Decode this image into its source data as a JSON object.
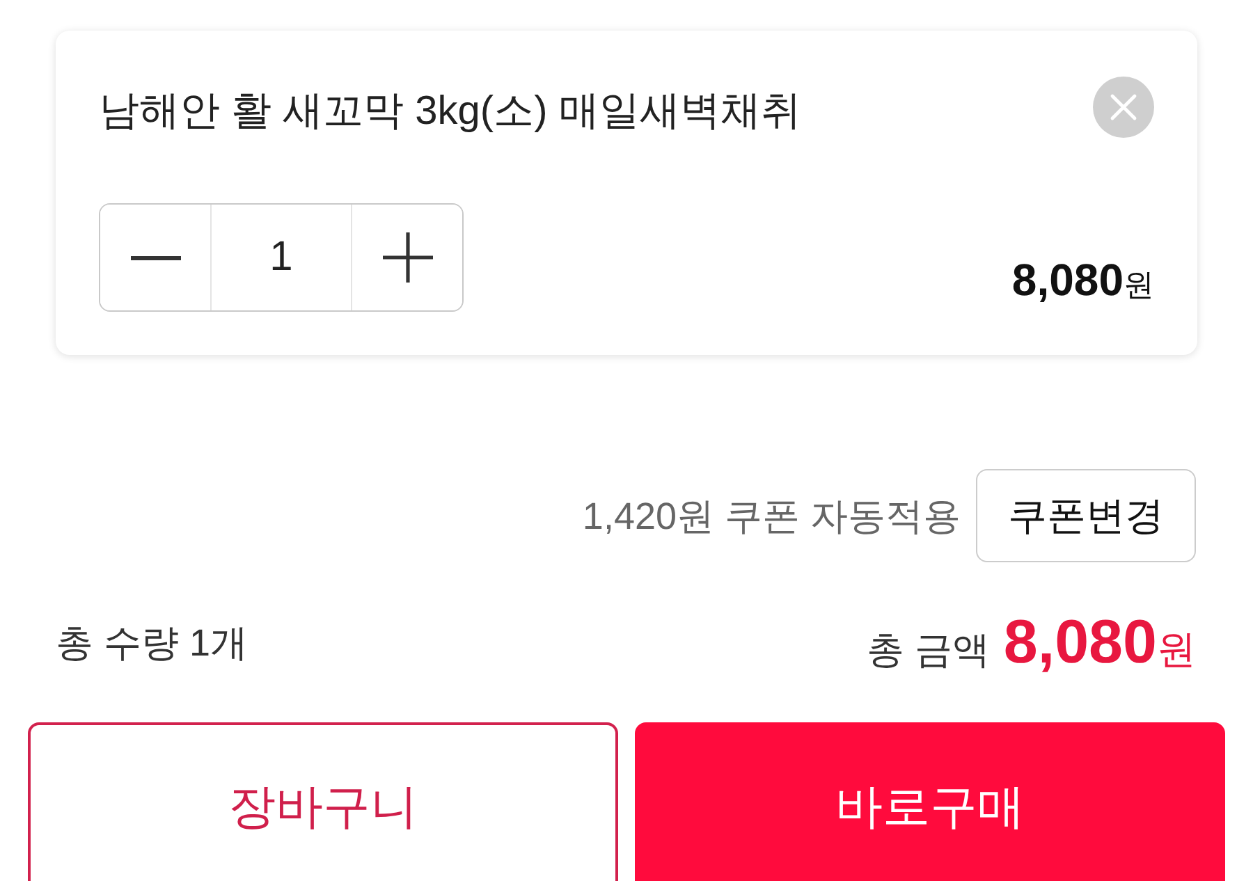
{
  "product": {
    "title": "남해안 활 새꼬막 3kg(소) 매일새벽채취",
    "quantity": "1",
    "price": {
      "amount": "8,080",
      "unit": "원"
    }
  },
  "coupon": {
    "text": "1,420원 쿠폰 자동적용",
    "button": "쿠폰변경"
  },
  "summary": {
    "quantity_text": "총 수량 1개",
    "total_label": "총 금액",
    "total": {
      "amount": "8,080",
      "unit": "원"
    }
  },
  "actions": [
    {
      "label": "장바구니",
      "kind": "outline"
    },
    {
      "label": "바로구매",
      "kind": "filled"
    }
  ]
}
